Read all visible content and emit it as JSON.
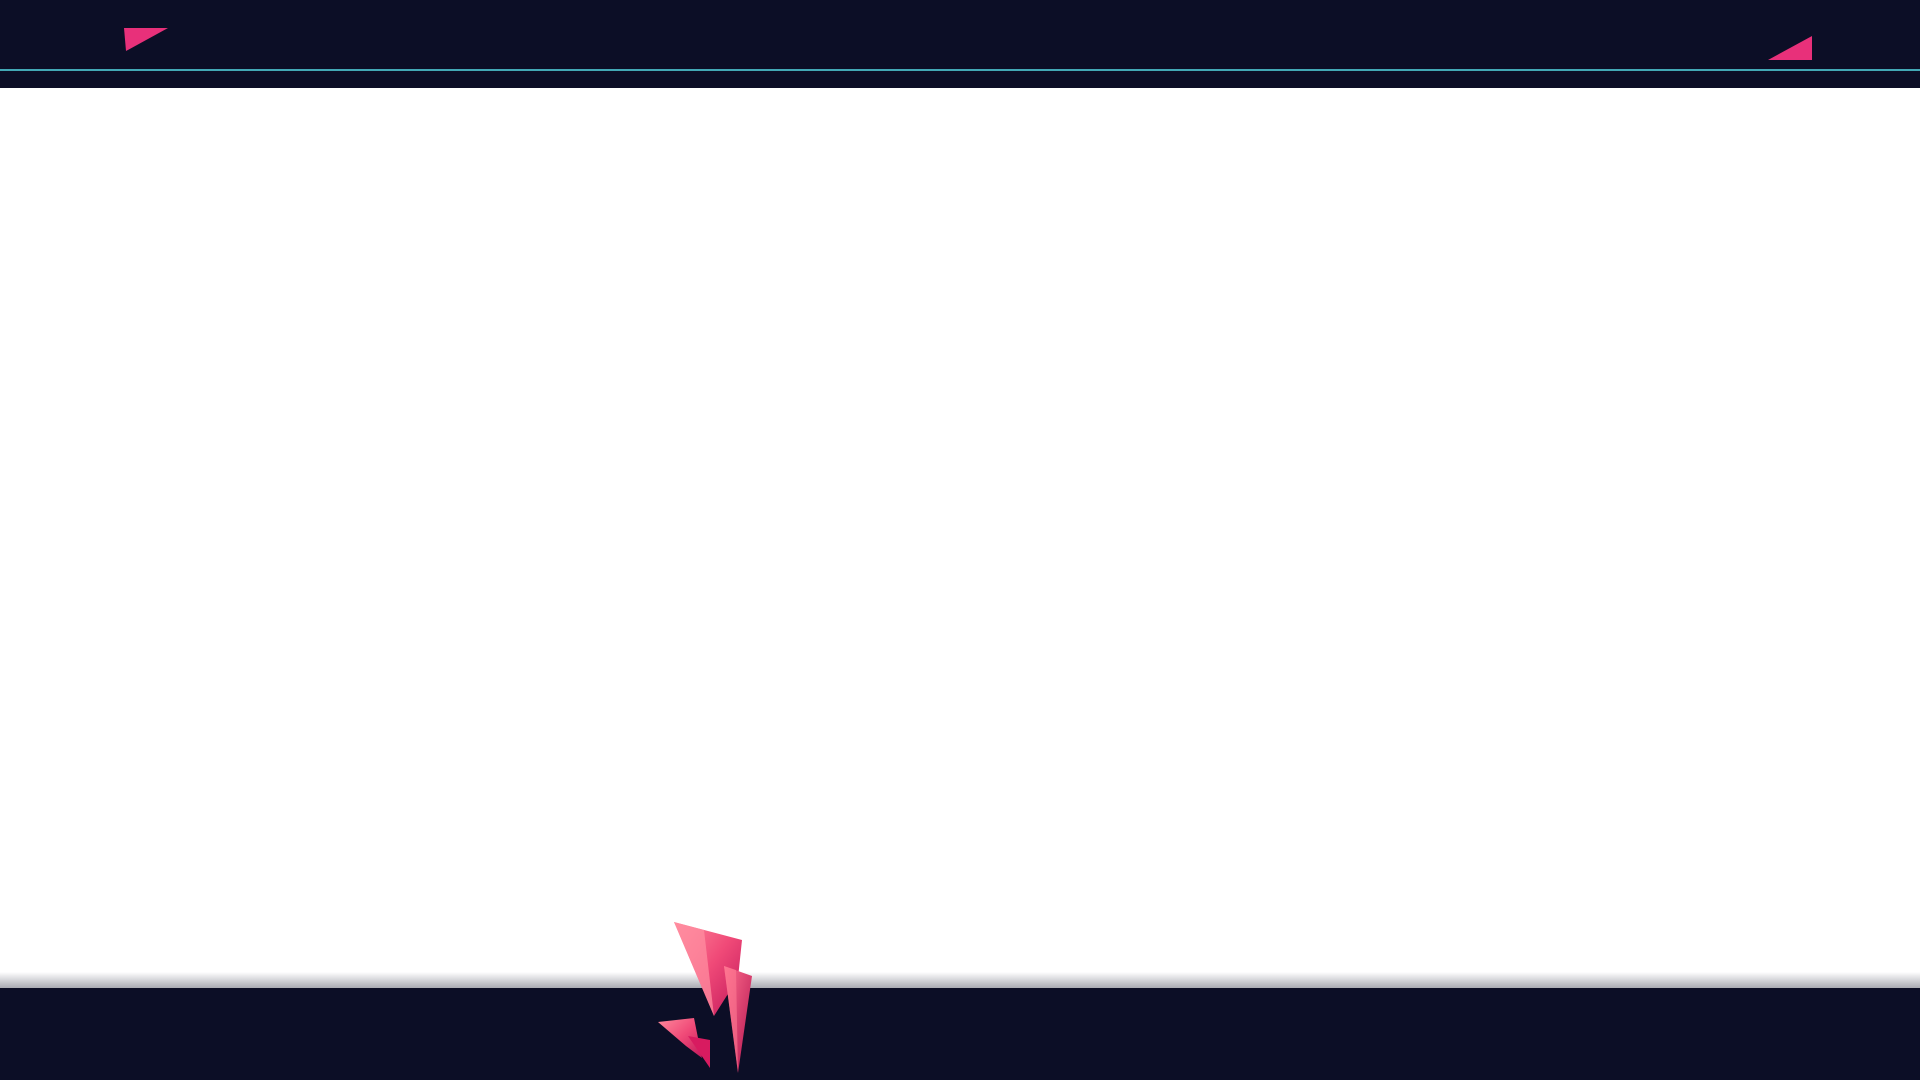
{
  "theme": {
    "bar_color": "#0c0e26",
    "line_color": "#4ec3cf",
    "accent": "#e8307a",
    "accent_light": "#ff6f8e",
    "background": "#ffffff"
  },
  "decorations": {
    "top_left": "pink-triangle-icon",
    "top_right": "pink-triangle-icon",
    "bottom": "pink-crystal-shard-icon"
  }
}
